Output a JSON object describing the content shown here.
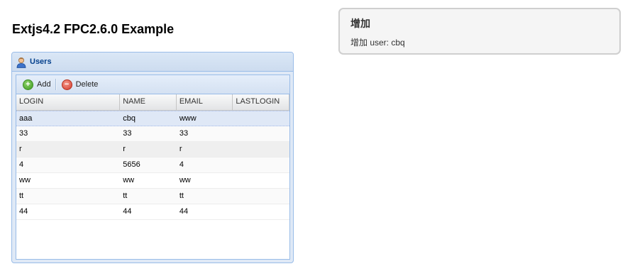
{
  "page": {
    "title": "Extjs4.2 FPC2.6.0 Example"
  },
  "panel": {
    "title": "Users",
    "toolbar": {
      "add_label": "Add",
      "delete_label": "Delete"
    },
    "columns": [
      "LOGIN",
      "NAME",
      "EMAIL",
      "LASTLOGIN"
    ],
    "rows": [
      [
        "aaa",
        "cbq",
        "www",
        ""
      ],
      [
        "33",
        "33",
        "33",
        ""
      ],
      [
        "r",
        "r",
        "r",
        ""
      ],
      [
        "4",
        "5656",
        "4",
        ""
      ],
      [
        "ww",
        "ww",
        "ww",
        ""
      ],
      [
        "tt",
        "tt",
        "tt",
        ""
      ],
      [
        "44",
        "44",
        "44",
        ""
      ]
    ],
    "selected_row": 0,
    "hover_row": 2
  },
  "toast": {
    "title": "增加",
    "message": "增加 user: cbq"
  },
  "colors": {
    "panel_border": "#99bce8",
    "title_blue": "#04408c",
    "selected_row": "#dfe8f6"
  }
}
